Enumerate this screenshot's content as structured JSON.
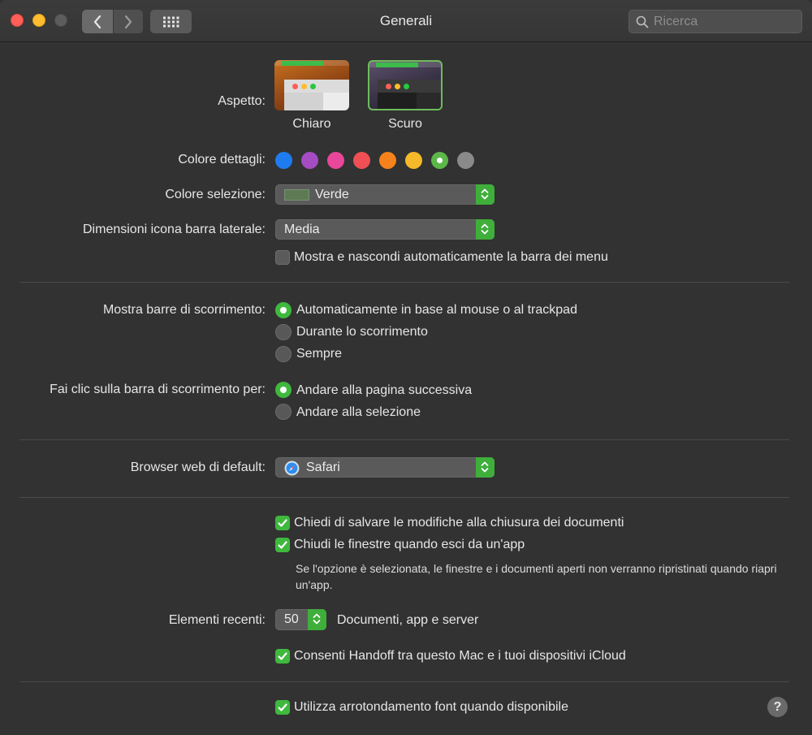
{
  "window": {
    "title": "Generali"
  },
  "search": {
    "placeholder": "Ricerca"
  },
  "appearance": {
    "label": "Aspetto:",
    "options": [
      {
        "label": "Chiaro",
        "selected": false
      },
      {
        "label": "Scuro",
        "selected": true
      }
    ]
  },
  "accent": {
    "label": "Colore dettagli:",
    "colors": [
      "#1f7cf0",
      "#a54cc2",
      "#e9479b",
      "#f04f55",
      "#f7821b",
      "#f5b929",
      "#5cb848",
      "#8a8a8a"
    ],
    "selected_index": 6
  },
  "highlight": {
    "label": "Colore selezione:",
    "value": "Verde",
    "chip_color": "#5e7a55"
  },
  "sidebar_icon": {
    "label": "Dimensioni icona barra laterale:",
    "value": "Media"
  },
  "menubar_autohide": {
    "label": "Mostra e nascondi automaticamente la barra dei menu",
    "checked": false
  },
  "scrollbars": {
    "label": "Mostra barre di scorrimento:",
    "options": [
      {
        "label": "Automaticamente in base al mouse o al trackpad",
        "selected": true
      },
      {
        "label": "Durante lo scorrimento",
        "selected": false
      },
      {
        "label": "Sempre",
        "selected": false
      }
    ]
  },
  "scroll_click": {
    "label": "Fai clic sulla barra di scorrimento per:",
    "options": [
      {
        "label": "Andare alla pagina successiva",
        "selected": true
      },
      {
        "label": "Andare alla selezione",
        "selected": false
      }
    ]
  },
  "browser": {
    "label": "Browser web di default:",
    "value": "Safari"
  },
  "ask_save": {
    "label": "Chiedi di salvare le modifiche alla chiusura dei documenti",
    "checked": true
  },
  "close_windows": {
    "label": "Chiudi le finestre quando esci da un'app",
    "checked": true
  },
  "close_note": "Se l'opzione è selezionata, le finestre e i documenti aperti non verranno ripristinati quando riapri un'app.",
  "recent": {
    "label": "Elementi recenti:",
    "value": "50",
    "suffix": "Documenti, app e server"
  },
  "handoff": {
    "label": "Consenti Handoff tra questo Mac e i tuoi dispositivi iCloud",
    "checked": true
  },
  "font_smoothing": {
    "label": "Utilizza arrotondamento font quando disponibile",
    "checked": true
  },
  "help": {
    "label": "?"
  }
}
